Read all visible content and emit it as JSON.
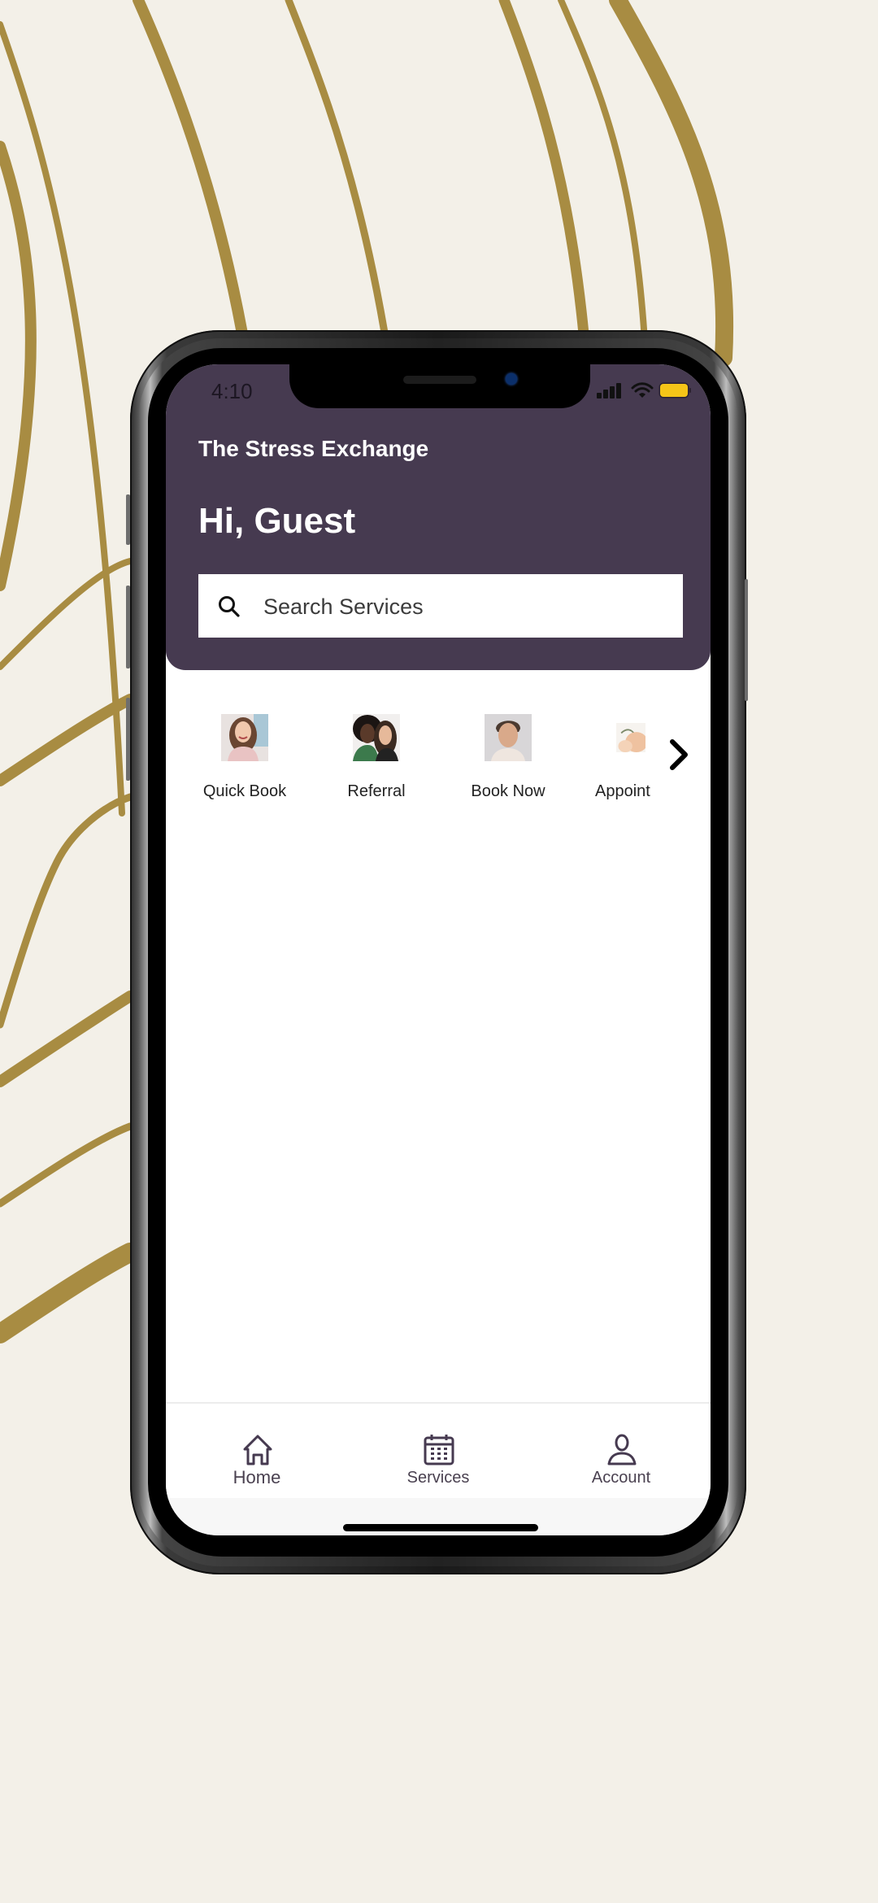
{
  "colors": {
    "background": "#f3f0e8",
    "decor_lines": "#a88c42",
    "header_bg": "#463a50",
    "battery": "#f5c518"
  },
  "status_bar": {
    "time": "4:10",
    "icons": [
      "cellular-signal-icon",
      "wifi-icon",
      "battery-icon"
    ]
  },
  "header": {
    "brand": "The Stress Exchange",
    "greeting": "Hi, Guest"
  },
  "search": {
    "placeholder": "Search Services",
    "value": "",
    "icon": "search-icon"
  },
  "quick_actions": {
    "items": [
      {
        "label": "Quick Book",
        "image": "woman-smiling-photo"
      },
      {
        "label": "Referral",
        "image": "two-women-photo"
      },
      {
        "label": "Book Now",
        "image": "man-portrait-photo"
      },
      {
        "label": "Appoint",
        "image": "spa-massage-photo"
      }
    ],
    "next_icon": "chevron-right-icon"
  },
  "tab_bar": {
    "items": [
      {
        "label": "Home",
        "icon": "home-icon"
      },
      {
        "label": "Services",
        "icon": "calendar-icon"
      },
      {
        "label": "Account",
        "icon": "user-icon"
      }
    ]
  }
}
